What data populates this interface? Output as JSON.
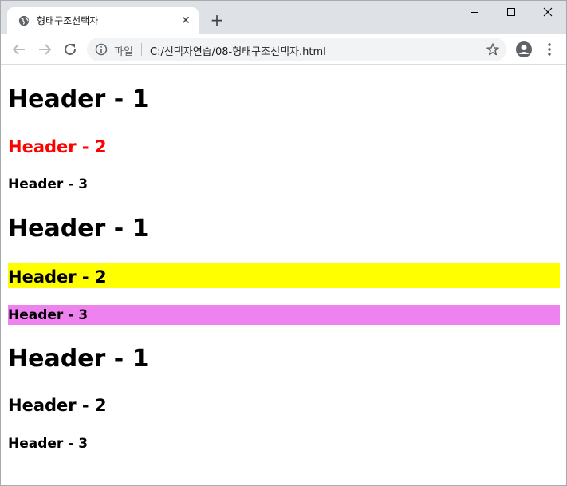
{
  "browser": {
    "tab_title": "형태구조선택자",
    "tab_close": "✕",
    "new_tab": "+",
    "file_label": "파일",
    "url": "C:/선택자연습/08-형태구조선택자.html"
  },
  "content": {
    "groups": [
      {
        "h1": "Header - 1",
        "h2": "Header - 2",
        "h3": "Header - 3"
      },
      {
        "h1": "Header - 1",
        "h2": "Header - 2",
        "h3": "Header - 3"
      },
      {
        "h1": "Header - 1",
        "h2": "Header - 2",
        "h3": "Header - 3"
      }
    ]
  },
  "colors": {
    "red_header": "#ff0000",
    "yellow_bg": "#ffff00",
    "violet_bg": "#ee82ee"
  }
}
